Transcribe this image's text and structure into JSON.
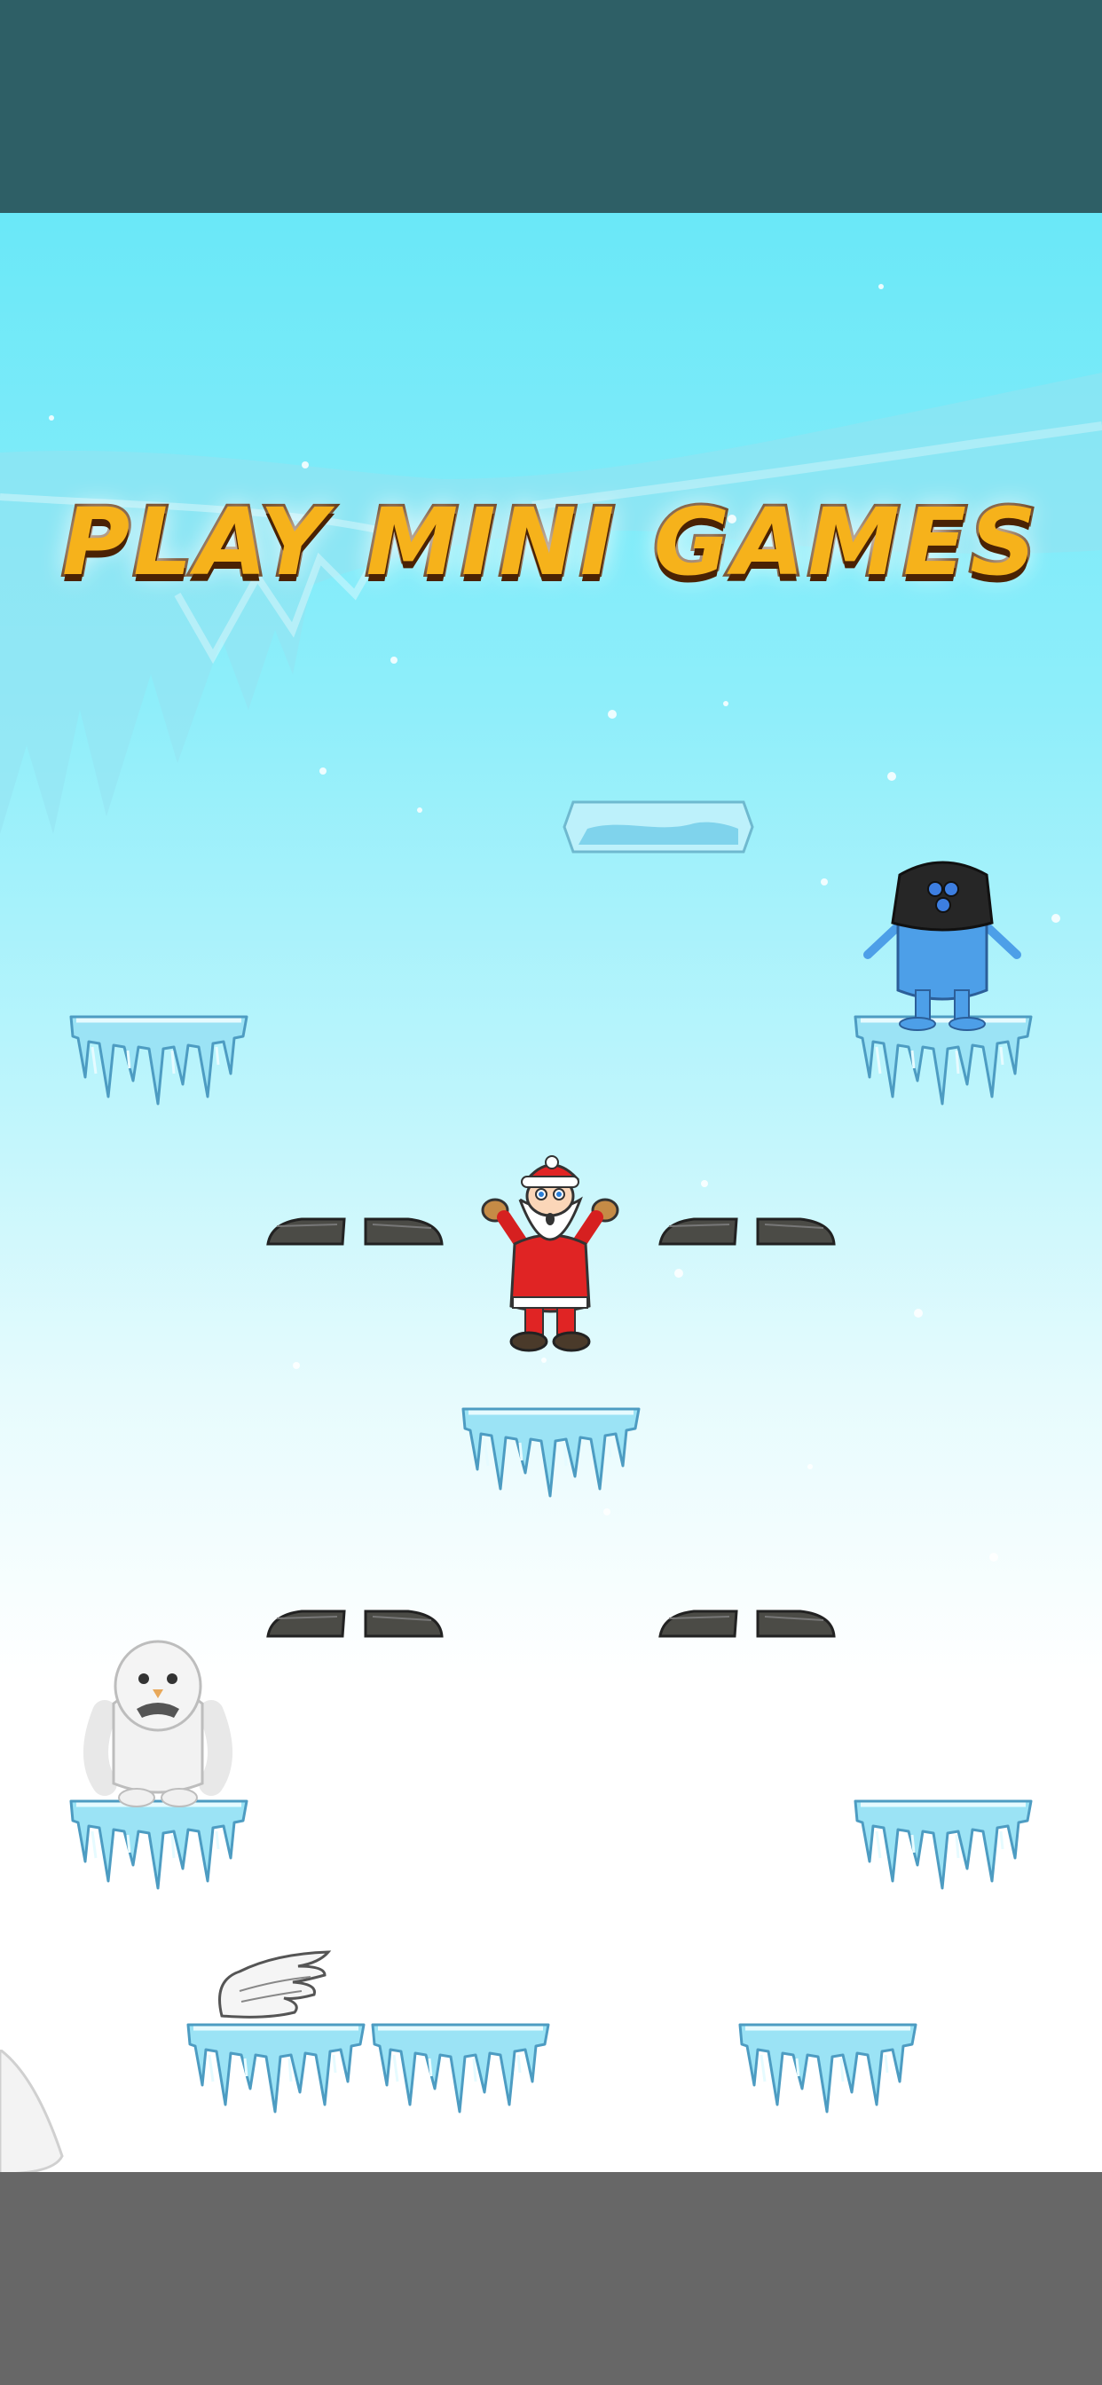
{
  "title": "PLAY MINI GAMES",
  "colors": {
    "top_bar": "#2e5f66",
    "bottom_bar": "#676767",
    "sky_top": "#6ae8f8",
    "sky_bottom": "#ffffff",
    "title_fill": "#f6b21b",
    "title_outline": "#5b2c05",
    "ice": "#9be3f5",
    "rock": "#4b4b46"
  },
  "characters": [
    "santa-character",
    "blue-monster-character",
    "yeti-character"
  ],
  "items": [
    "wing-powerup-icon"
  ]
}
